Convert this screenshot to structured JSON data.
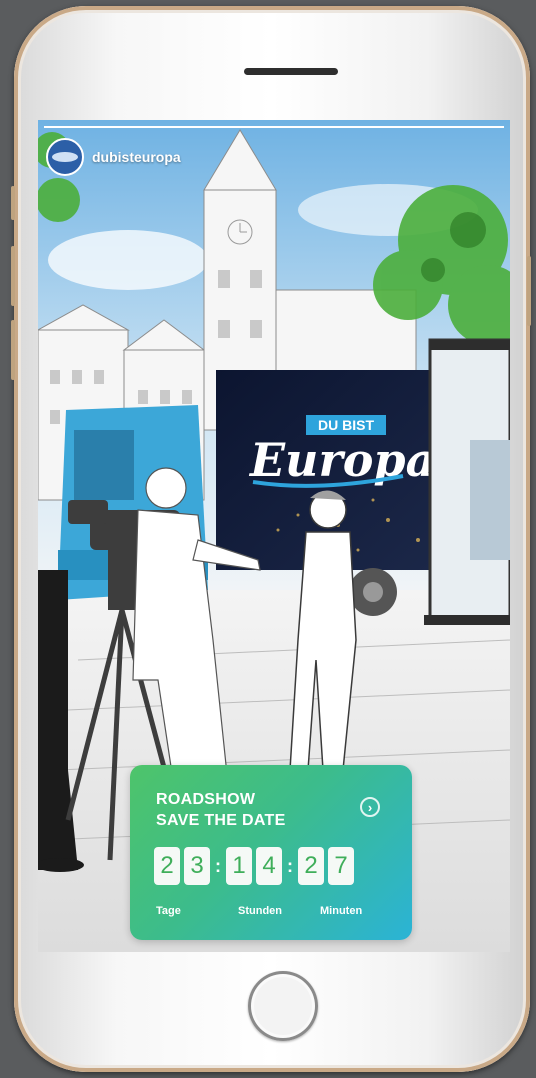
{
  "story": {
    "username": "dubisteuropa",
    "avatar_icon": "avatar-icon",
    "progress": 1.0
  },
  "illustration": {
    "truck_headline_small": "DU BIST",
    "truck_headline_large": "Europa"
  },
  "countdown": {
    "title_line1": "ROADSHOW",
    "title_line2": "SAVE THE DATE",
    "arrow_icon": "chevron-right-icon",
    "days": [
      "2",
      "3"
    ],
    "hours": [
      "1",
      "4"
    ],
    "minutes": [
      "2",
      "7"
    ],
    "separator": ":",
    "label_days": "Tage",
    "label_hours": "Stunden",
    "label_minutes": "Minuten",
    "gradient": [
      "#4ec46a",
      "#2bb3d6"
    ],
    "digit_color": "#3fae5a"
  },
  "device": {
    "frame_color": "#f7f7f7",
    "accent_color": "#c9a987"
  }
}
